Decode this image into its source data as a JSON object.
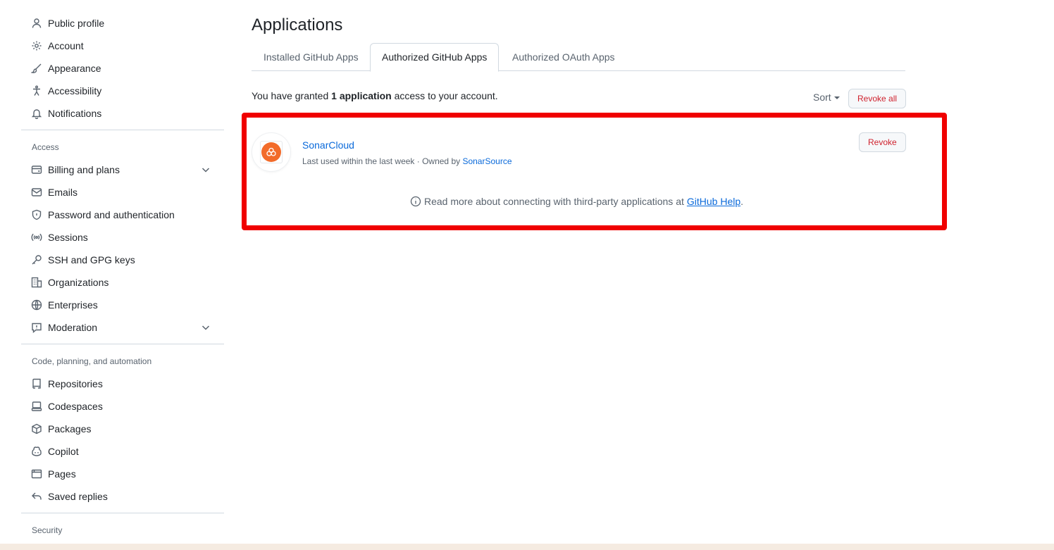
{
  "sidebar": {
    "top_items": [
      {
        "label": "Public profile",
        "icon": "person-icon"
      },
      {
        "label": "Account",
        "icon": "gear-icon"
      },
      {
        "label": "Appearance",
        "icon": "paintbrush-icon"
      },
      {
        "label": "Accessibility",
        "icon": "accessibility-icon"
      },
      {
        "label": "Notifications",
        "icon": "bell-icon"
      }
    ],
    "access_heading": "Access",
    "access_items": [
      {
        "label": "Billing and plans",
        "icon": "credit-card-icon"
      },
      {
        "label": "Emails",
        "icon": "mail-icon"
      },
      {
        "label": "Password and authentication",
        "icon": "shield-icon"
      },
      {
        "label": "Sessions",
        "icon": "broadcast-icon"
      },
      {
        "label": "SSH and GPG keys",
        "icon": "key-icon"
      },
      {
        "label": "Organizations",
        "icon": "organization-icon"
      },
      {
        "label": "Enterprises",
        "icon": "globe-icon"
      },
      {
        "label": "Moderation",
        "icon": "report-icon"
      }
    ],
    "code_heading": "Code, planning, and automation",
    "code_items": [
      {
        "label": "Repositories",
        "icon": "repo-icon"
      },
      {
        "label": "Codespaces",
        "icon": "codespaces-icon"
      },
      {
        "label": "Packages",
        "icon": "package-icon"
      },
      {
        "label": "Copilot",
        "icon": "copilot-icon"
      },
      {
        "label": "Pages",
        "icon": "browser-icon"
      },
      {
        "label": "Saved replies",
        "icon": "reply-icon"
      }
    ],
    "security_heading": "Security"
  },
  "main": {
    "title": "Applications",
    "tabs": [
      {
        "label": "Installed GitHub Apps",
        "active": false
      },
      {
        "label": "Authorized GitHub Apps",
        "active": true
      },
      {
        "label": "Authorized OAuth Apps",
        "active": false
      }
    ],
    "granted_prefix": "You have granted ",
    "granted_count": "1 application",
    "granted_suffix": " access to your account.",
    "sort_label": "Sort",
    "revoke_all_label": "Revoke all",
    "app": {
      "name": "SonarCloud",
      "last_used": "Last used within the last week · Owned by ",
      "owner": "SonarSource",
      "revoke_label": "Revoke",
      "logo_color": "#f26b2a"
    },
    "help_prefix": "Read more about connecting with third-party applications at",
    "help_link": "GitHub Help",
    "help_suffix": "."
  },
  "colors": {
    "highlight": "#f00000",
    "link": "#0969da",
    "danger": "#cf222e"
  }
}
